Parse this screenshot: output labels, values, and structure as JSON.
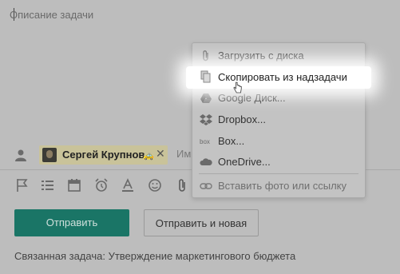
{
  "description": {
    "placeholder": "Описание задачи"
  },
  "assignee": {
    "chip_name": "Сергей Крупнов",
    "car_icon": "🚕",
    "remove": "✕",
    "input_placeholder": "Им"
  },
  "toolbar": {
    "icons": [
      "flag-icon",
      "list-icon",
      "calendar-icon",
      "alarm-icon",
      "text-color-icon",
      "emoji-icon",
      "attach-icon"
    ]
  },
  "buttons": {
    "send": "Отправить",
    "send_and_new": "Отправить и новая"
  },
  "related_task": "Связанная задача: Утверждение маркетингового бюджета",
  "attach_menu": {
    "items": [
      {
        "label": "Загрузить с диска",
        "icon": "paperclip-icon"
      },
      {
        "label": "Скопировать из надзадачи",
        "icon": "copy-icon"
      },
      {
        "label": "Google Диск...",
        "icon": "google-drive-icon"
      },
      {
        "label": "Dropbox...",
        "icon": "dropbox-icon"
      },
      {
        "label": "Box...",
        "icon": "box-icon"
      },
      {
        "label": "OneDrive...",
        "icon": "onedrive-icon"
      },
      {
        "label": "Вставить фото или ссылку",
        "icon": "link-icon"
      }
    ],
    "highlighted_index": 1
  },
  "colors": {
    "send_button": "#1a7566",
    "chip": "#c9c39a",
    "overlay": "#bdbdbd"
  }
}
